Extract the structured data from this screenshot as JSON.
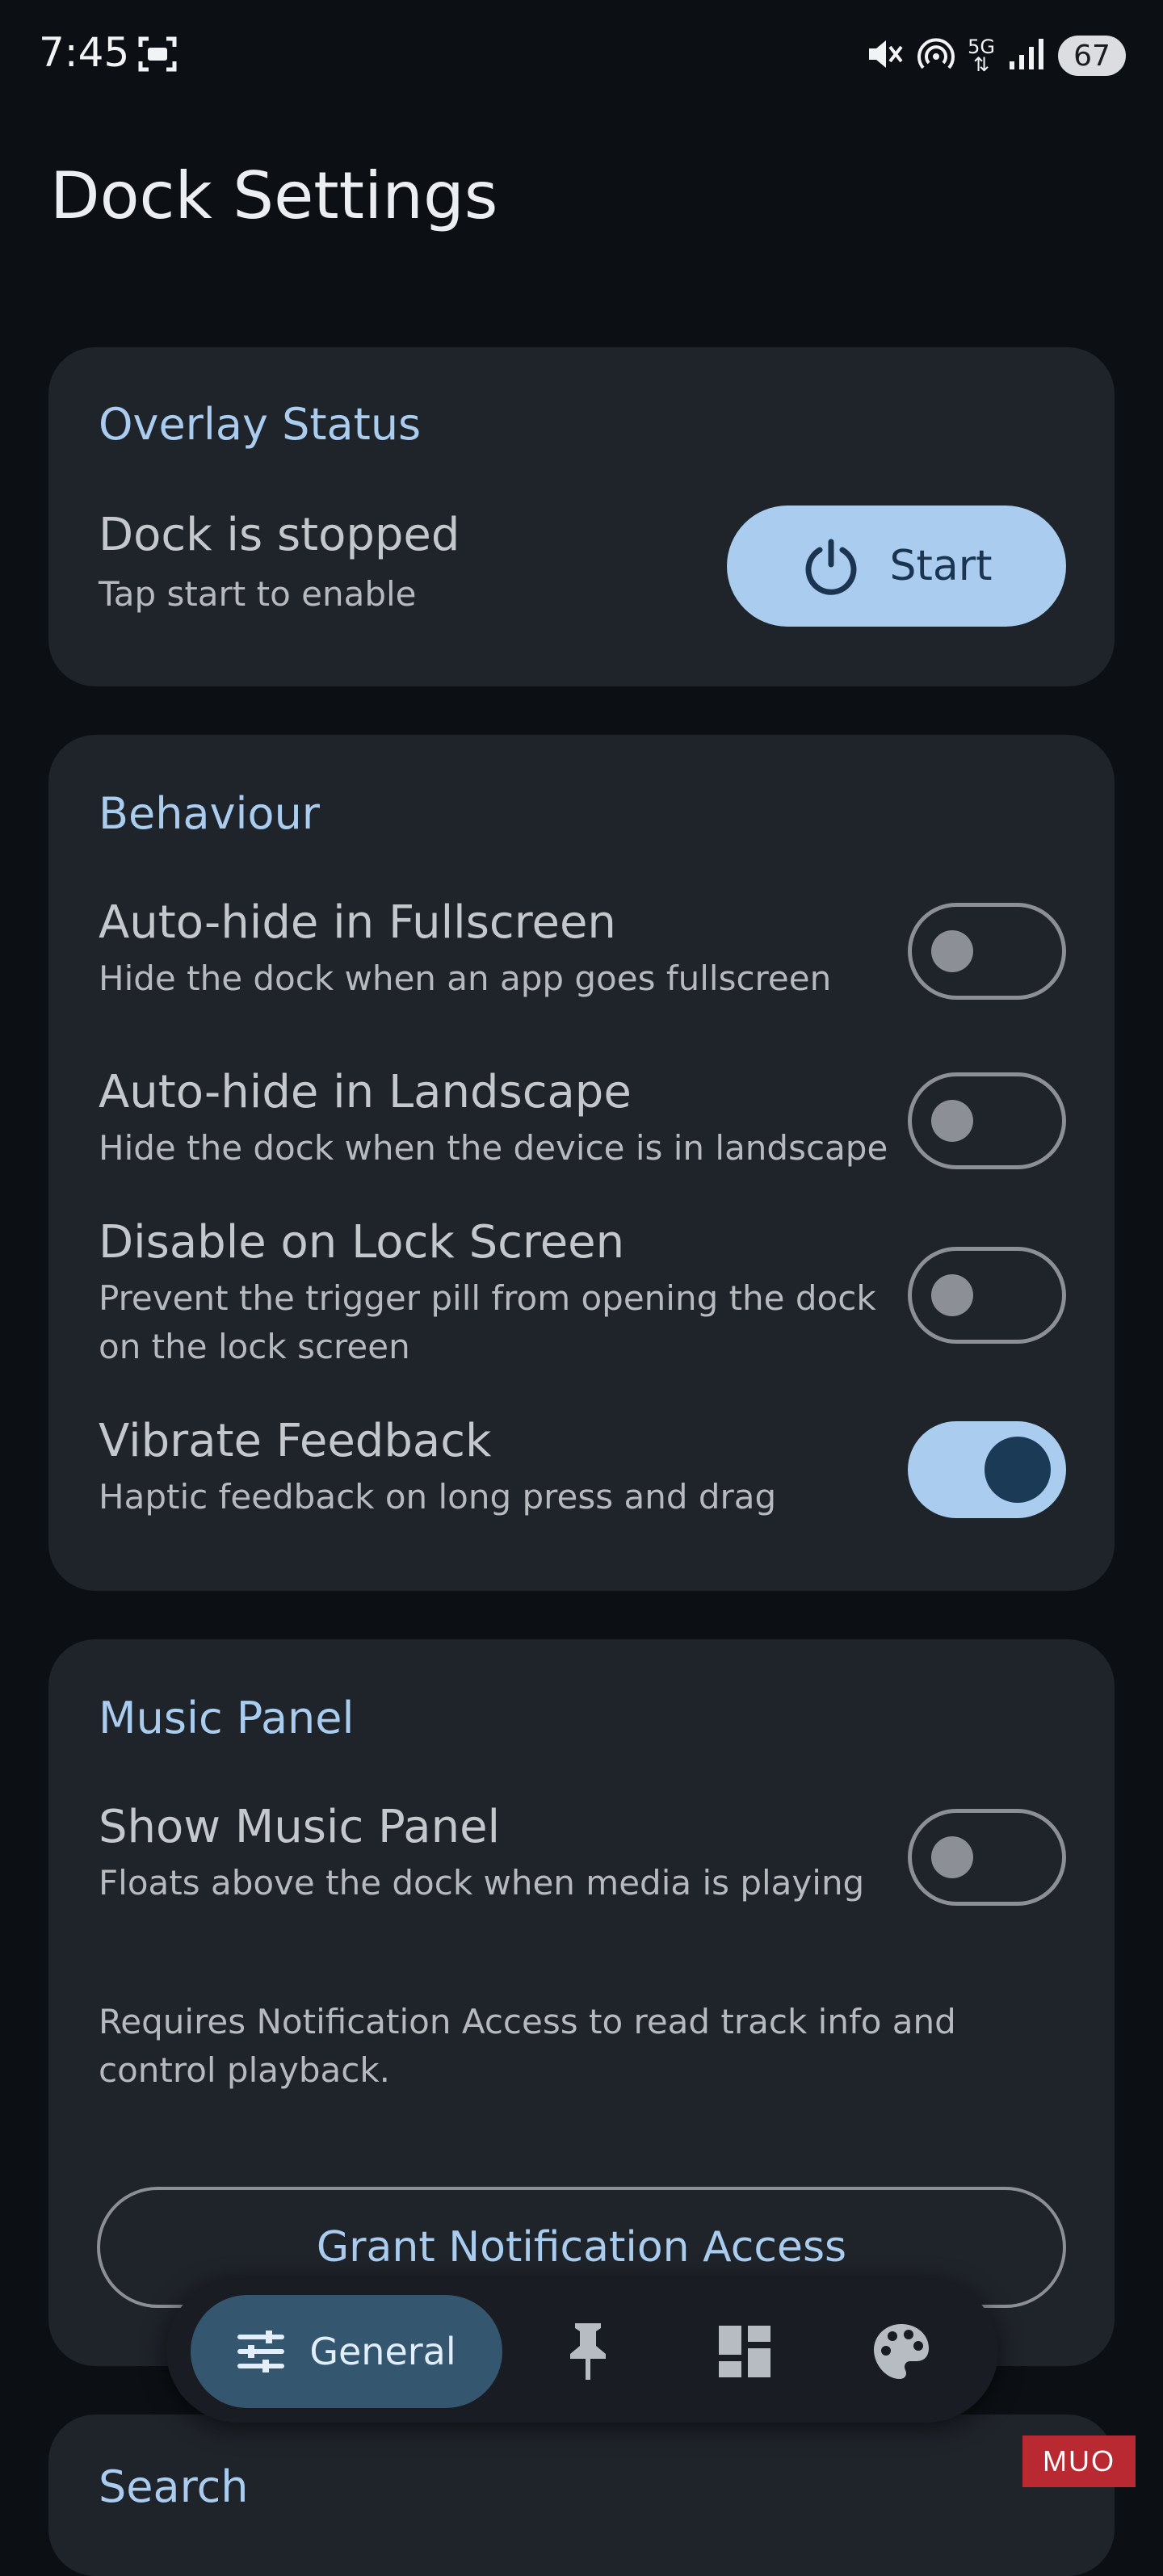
{
  "status_bar": {
    "time": "7:45",
    "battery": "67",
    "network": "5G",
    "icons": [
      "screenshot-icon",
      "mute-icon",
      "hotspot-icon",
      "5g-icon",
      "signal-icon",
      "battery-icon"
    ]
  },
  "page": {
    "title": "Dock Settings"
  },
  "overlay_status": {
    "title": "Overlay Status",
    "state": "Dock is stopped",
    "hint": "Tap start to enable",
    "start_label": "Start"
  },
  "behaviour": {
    "title": "Behaviour",
    "items": [
      {
        "title": "Auto-hide in Fullscreen",
        "subtitle": "Hide the dock when an app goes fullscreen",
        "enabled": false
      },
      {
        "title": "Auto-hide in Landscape",
        "subtitle": "Hide the dock when the device is in landscape",
        "enabled": false
      },
      {
        "title": "Disable on Lock Screen",
        "subtitle": "Prevent the trigger pill from opening the dock on the lock screen",
        "enabled": false
      },
      {
        "title": "Vibrate Feedback",
        "subtitle": "Haptic feedback on long press and drag",
        "enabled": true
      }
    ]
  },
  "music_panel": {
    "title": "Music Panel",
    "item": {
      "title": "Show Music Panel",
      "subtitle": "Floats above the dock when media is playing",
      "enabled": false
    },
    "note": "Requires Notification Access to read track info and control playback.",
    "grant_label": "Grant Notification Access"
  },
  "search": {
    "title": "Search"
  },
  "bottom_nav": {
    "active_label": "General",
    "icons": [
      "tune-icon",
      "pin-icon",
      "dashboard-icon",
      "palette-icon"
    ]
  },
  "watermark": "MUO",
  "colors": {
    "accent": "#a9ccef",
    "card": "#1f232a",
    "background": "#0c1014"
  }
}
